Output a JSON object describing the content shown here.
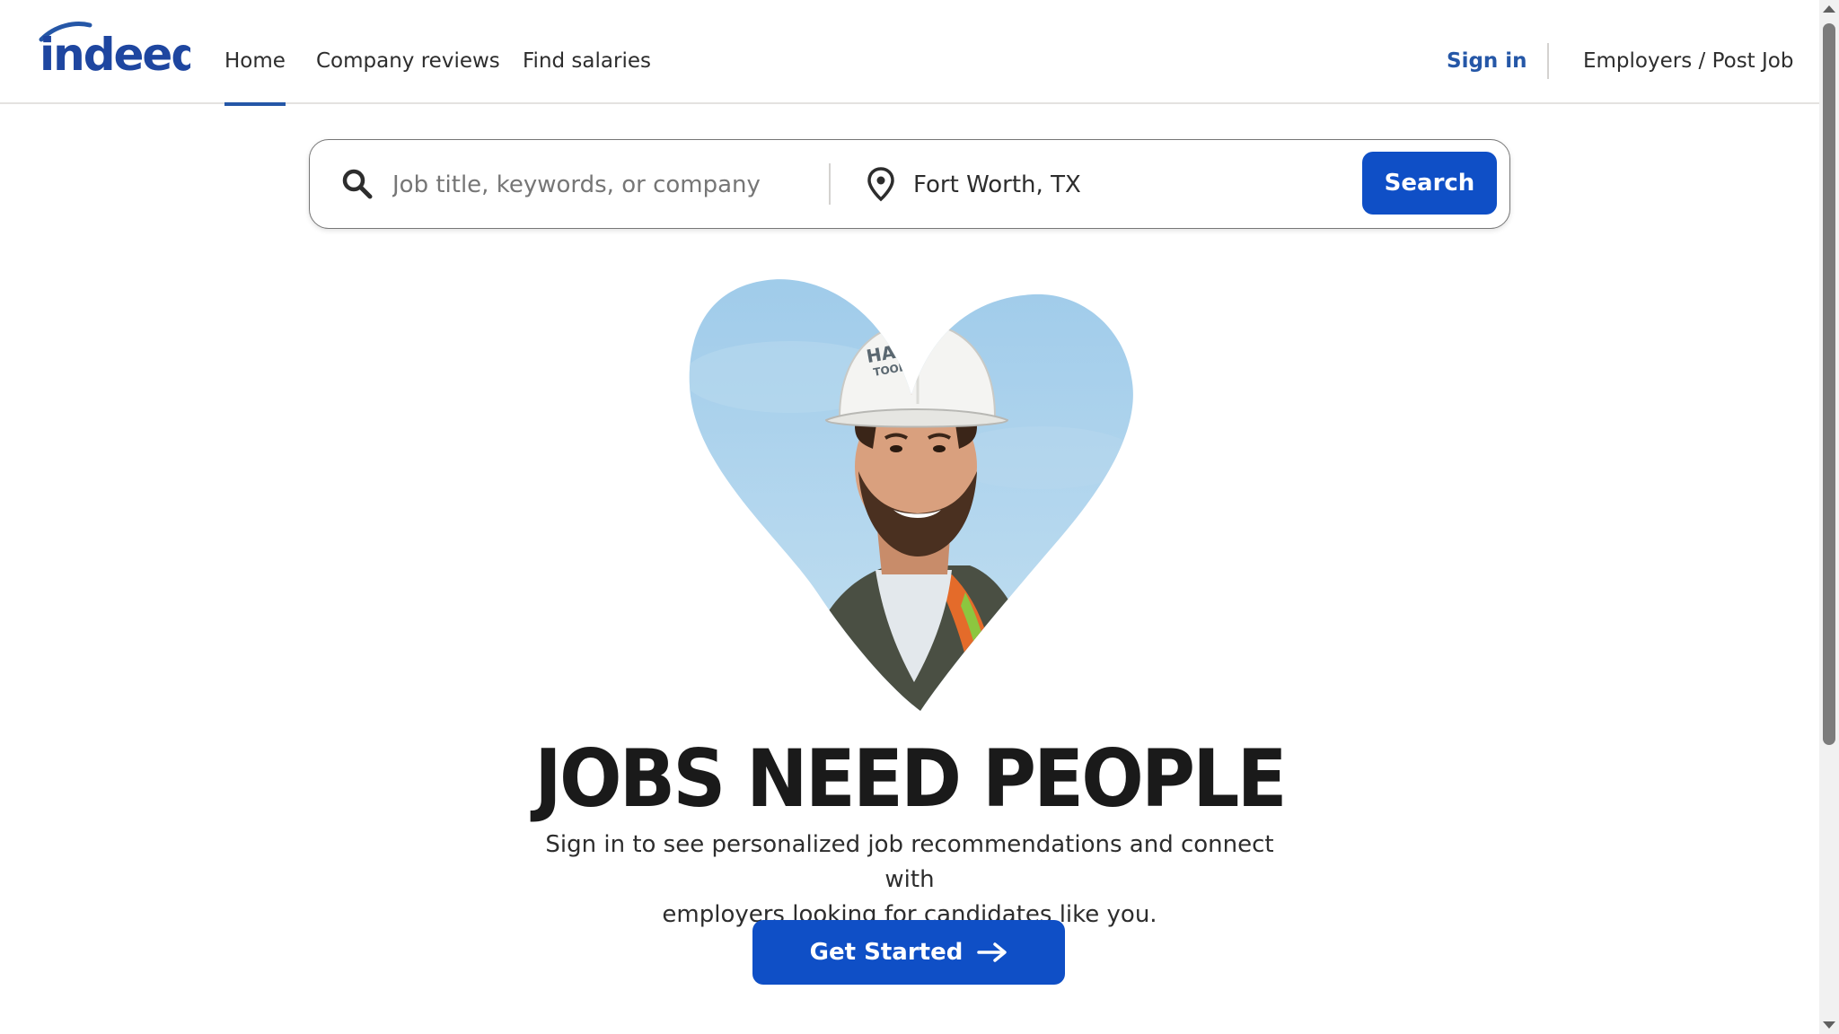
{
  "brand": {
    "logo_text": "indeed",
    "accent_color": "#2557a7",
    "button_color": "#0f4fc6"
  },
  "nav": {
    "items": [
      {
        "label": "Home",
        "active": true
      },
      {
        "label": "Company reviews",
        "active": false
      },
      {
        "label": "Find salaries",
        "active": false
      }
    ],
    "sign_in": "Sign in",
    "employers": "Employers / Post Job"
  },
  "search": {
    "what_placeholder": "Job title, keywords, or company",
    "what_value": "",
    "where_value": "Fort Worth, TX",
    "button_label": "Search",
    "what_icon": "search-icon",
    "where_icon": "location-pin-icon"
  },
  "hero": {
    "image": "heart-shaped-photo-construction-worker",
    "hard_hat_text": [
      "HALE",
      "TOOLS"
    ],
    "headline": "JOBS NEED PEOPLE",
    "subtext_line1": "Sign in to see personalized job recommendations and connect with",
    "subtext_line2": "employers looking for candidates like you.",
    "cta_label": "Get Started",
    "cta_icon": "arrow-right-icon"
  }
}
